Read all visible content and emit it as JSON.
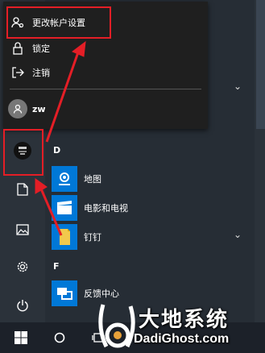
{
  "flyout": {
    "items": [
      {
        "label": "更改帐户设置",
        "icon": "account-settings-icon"
      },
      {
        "label": "锁定",
        "icon": "lock-icon"
      },
      {
        "label": "注销",
        "icon": "sign-out-icon"
      }
    ],
    "user": {
      "name": "zw",
      "icon": "user-avatar-icon"
    }
  },
  "left_rail": [
    {
      "name": "user-avatar-button",
      "icon": "user-photo-icon"
    },
    {
      "name": "documents-button",
      "icon": "document-icon"
    },
    {
      "name": "pictures-button",
      "icon": "picture-icon"
    },
    {
      "name": "settings-button",
      "icon": "gear-icon"
    },
    {
      "name": "power-button",
      "icon": "power-icon"
    }
  ],
  "app_list": {
    "group_d": "D",
    "group_f": "F",
    "apps": [
      {
        "label": "地图",
        "icon": "maps-icon",
        "color": "#0078d7"
      },
      {
        "label": "电影和电视",
        "icon": "movies-tv-icon",
        "color": "#0078d7"
      },
      {
        "label": "钉钉",
        "icon": "dingtalk-icon",
        "color": "#0078d7"
      },
      {
        "label": "反馈中心",
        "icon": "feedback-hub-icon",
        "color": "#0078d7"
      }
    ]
  },
  "watermark": {
    "brand": "大地系统",
    "url": "DadiGhost.com"
  },
  "colors": {
    "highlight": "#e41e26",
    "accent": "#0078d7"
  }
}
